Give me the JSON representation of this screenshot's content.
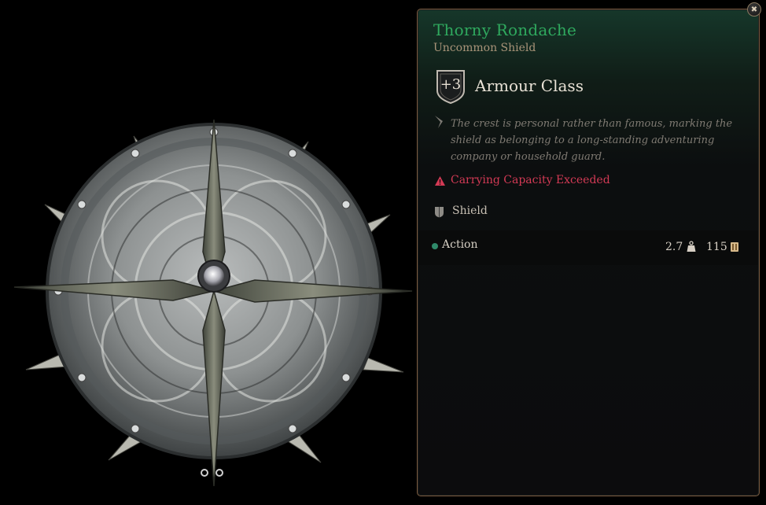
{
  "item": {
    "name": "Thorny Rondache",
    "rarity": "Uncommon Shield",
    "armour_class": {
      "value": "+3",
      "label": "Armour Class"
    },
    "description": "The crest is personal rather than famous, marking the shield as belonging to a long-standing adventuring company or household guard.",
    "warning": "Carrying Capacity Exceeded",
    "type": "Shield",
    "action": "Action",
    "weight": "2.7",
    "price": "115"
  },
  "icons": {
    "close": "close-icon",
    "armour": "shield-badge-icon",
    "description": "quill-icon",
    "warning": "warning-triangle-icon",
    "type": "shield-icon",
    "weight": "weight-icon",
    "price": "gold-icon"
  },
  "colors": {
    "rarity_uncommon": "#2fa95e",
    "warning": "#d33a55",
    "panel_border": "#7a5a3f",
    "action_dot": "#2f8a6a"
  }
}
